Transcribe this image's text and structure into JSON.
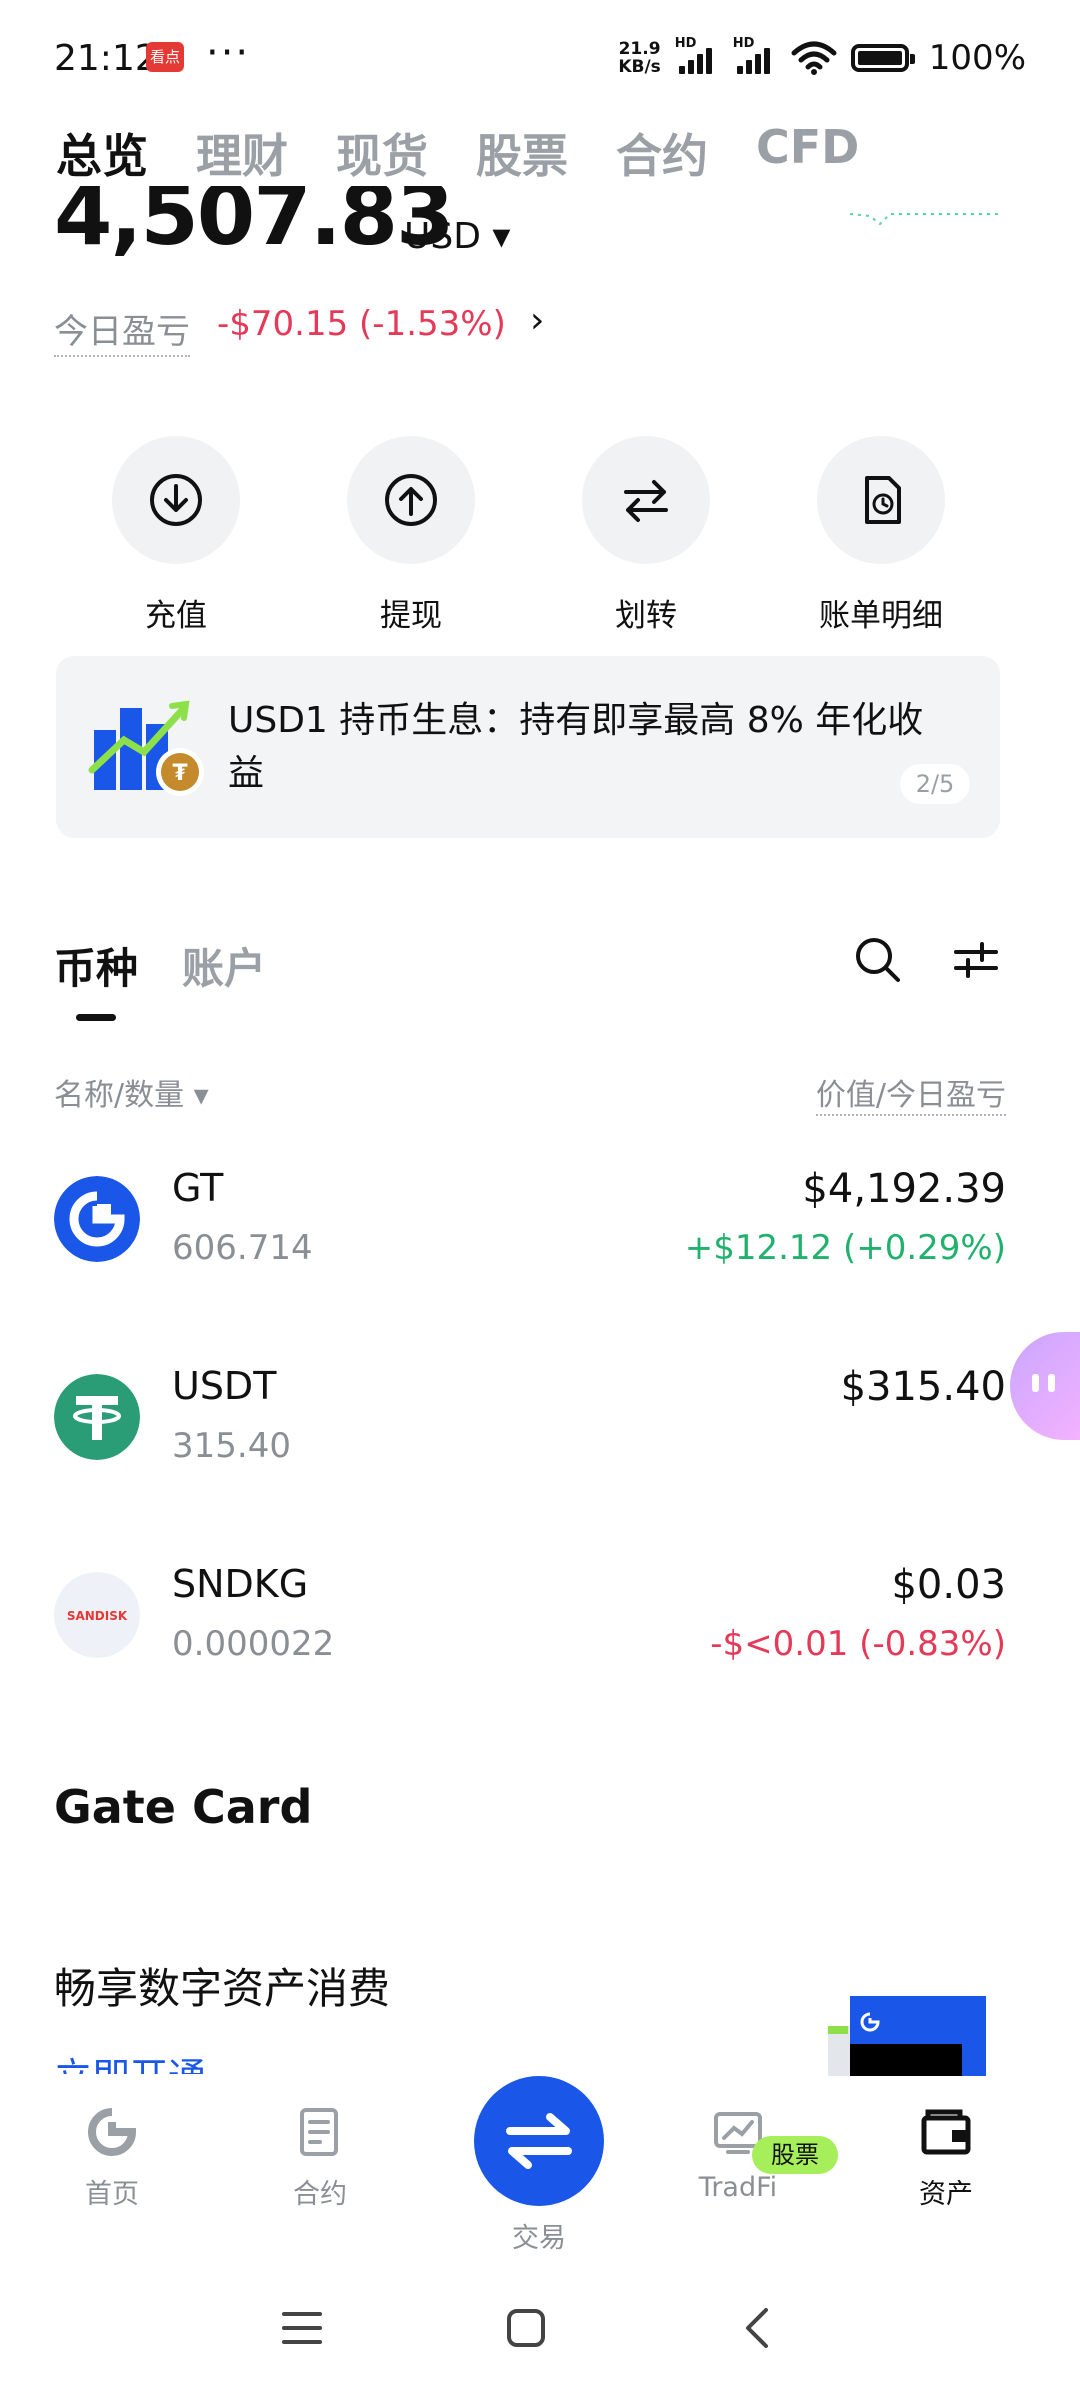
{
  "status_bar": {
    "time": "21:12",
    "app_badge": "看点",
    "more": "···",
    "net_speed_value": "21.9",
    "net_speed_unit": "KB/s",
    "hd": "HD",
    "battery": "100%"
  },
  "top_tabs": [
    "总览",
    "理财",
    "现货",
    "股票",
    "合约",
    "CFD"
  ],
  "balance": {
    "amount": "4,507.83",
    "currency": "USD ▾",
    "pnl_label": "今日盈亏",
    "pnl_value": "-$70.15 (-1.53%)",
    "pnl_chevron": "›"
  },
  "actions": [
    {
      "label": "充值",
      "icon": "deposit-icon"
    },
    {
      "label": "提现",
      "icon": "withdraw-icon"
    },
    {
      "label": "划转",
      "icon": "transfer-icon"
    },
    {
      "label": "账单明细",
      "icon": "statement-icon"
    }
  ],
  "banner": {
    "text": "USD1 持币生息：持有即享最高 8% 年化收益",
    "page": "2/5"
  },
  "list_tabs": [
    "币种",
    "账户"
  ],
  "columns": {
    "left": "名称/数量 ▾",
    "right": "价值/今日盈亏"
  },
  "assets": [
    {
      "name": "GT",
      "qty": "606.714",
      "value": "$4,192.39",
      "change": "+$12.12 (+0.29%)",
      "change_color": "#20b26c"
    },
    {
      "name": "USDT",
      "qty": "315.40",
      "value": "$315.40",
      "change": "",
      "change_color": "#20b26c"
    },
    {
      "name": "SNDKG",
      "qty": "0.000022",
      "value": "$0.03",
      "change": "-$<0.01 (-0.83%)",
      "change_color": "#e53958"
    }
  ],
  "sandisk_logo_text": "SANDISK",
  "gate_card": {
    "title": "Gate Card",
    "subtitle": "畅享数字资产消费",
    "link": "立即开通"
  },
  "bottom_nav": [
    {
      "label": "首页",
      "icon": "home-icon"
    },
    {
      "label": "合约",
      "icon": "futures-icon"
    },
    {
      "label": "交易",
      "icon": "trade-icon"
    },
    {
      "label": "TradFi",
      "icon": "tradfi-icon"
    },
    {
      "label": "资产",
      "icon": "wallet-icon"
    }
  ],
  "stock_badge": "股票",
  "colors": {
    "accent": "#1a57e8",
    "positive": "#20b26c",
    "negative": "#e53958"
  }
}
